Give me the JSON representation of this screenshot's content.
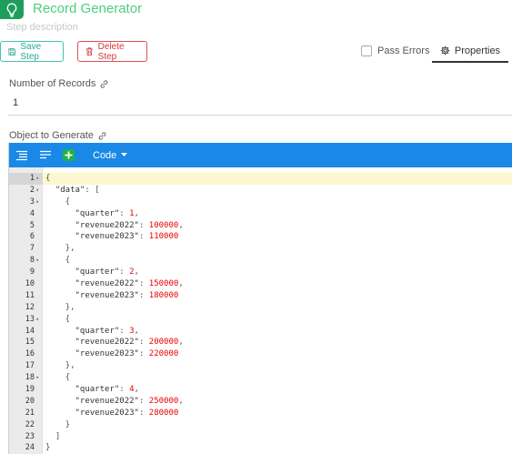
{
  "header": {
    "title": "Record Generator",
    "description_placeholder": "Step description"
  },
  "toolbar": {
    "save_label": "Save Step",
    "delete_label": "Delete Step",
    "pass_errors_label": "Pass Errors",
    "properties_label": "Properties"
  },
  "fields": {
    "records_label": "Number of Records",
    "records_value": "1",
    "object_label": "Object to Generate"
  },
  "editor": {
    "mode_label": "Code",
    "lines": [
      {
        "n": "1",
        "fold": true,
        "tokens": [
          [
            "p",
            "{"
          ]
        ]
      },
      {
        "n": "2",
        "fold": true,
        "tokens": [
          [
            "k",
            "  \"data\""
          ],
          [
            "p",
            ": ["
          ]
        ]
      },
      {
        "n": "3",
        "fold": true,
        "tokens": [
          [
            "p",
            "    {"
          ]
        ]
      },
      {
        "n": "4",
        "fold": false,
        "tokens": [
          [
            "k",
            "      \"quarter\""
          ],
          [
            "p",
            ": "
          ],
          [
            "n",
            "1"
          ],
          [
            "p",
            ","
          ]
        ]
      },
      {
        "n": "5",
        "fold": false,
        "tokens": [
          [
            "k",
            "      \"revenue2022\""
          ],
          [
            "p",
            ": "
          ],
          [
            "n",
            "100000"
          ],
          [
            "p",
            ","
          ]
        ]
      },
      {
        "n": "6",
        "fold": false,
        "tokens": [
          [
            "k",
            "      \"revenue2023\""
          ],
          [
            "p",
            ": "
          ],
          [
            "n",
            "110000"
          ]
        ]
      },
      {
        "n": "7",
        "fold": false,
        "tokens": [
          [
            "p",
            "    },"
          ]
        ]
      },
      {
        "n": "8",
        "fold": true,
        "tokens": [
          [
            "p",
            "    {"
          ]
        ]
      },
      {
        "n": "9",
        "fold": false,
        "tokens": [
          [
            "k",
            "      \"quarter\""
          ],
          [
            "p",
            ": "
          ],
          [
            "n",
            "2"
          ],
          [
            "p",
            ","
          ]
        ]
      },
      {
        "n": "10",
        "fold": false,
        "tokens": [
          [
            "k",
            "      \"revenue2022\""
          ],
          [
            "p",
            ": "
          ],
          [
            "n",
            "150000"
          ],
          [
            "p",
            ","
          ]
        ]
      },
      {
        "n": "11",
        "fold": false,
        "tokens": [
          [
            "k",
            "      \"revenue2023\""
          ],
          [
            "p",
            ": "
          ],
          [
            "n",
            "180000"
          ]
        ]
      },
      {
        "n": "12",
        "fold": false,
        "tokens": [
          [
            "p",
            "    },"
          ]
        ]
      },
      {
        "n": "13",
        "fold": true,
        "tokens": [
          [
            "p",
            "    {"
          ]
        ]
      },
      {
        "n": "14",
        "fold": false,
        "tokens": [
          [
            "k",
            "      \"quarter\""
          ],
          [
            "p",
            ": "
          ],
          [
            "n",
            "3"
          ],
          [
            "p",
            ","
          ]
        ]
      },
      {
        "n": "15",
        "fold": false,
        "tokens": [
          [
            "k",
            "      \"revenue2022\""
          ],
          [
            "p",
            ": "
          ],
          [
            "n",
            "200000"
          ],
          [
            "p",
            ","
          ]
        ]
      },
      {
        "n": "16",
        "fold": false,
        "tokens": [
          [
            "k",
            "      \"revenue2023\""
          ],
          [
            "p",
            ": "
          ],
          [
            "n",
            "220000"
          ]
        ]
      },
      {
        "n": "17",
        "fold": false,
        "tokens": [
          [
            "p",
            "    },"
          ]
        ]
      },
      {
        "n": "18",
        "fold": true,
        "tokens": [
          [
            "p",
            "    {"
          ]
        ]
      },
      {
        "n": "19",
        "fold": false,
        "tokens": [
          [
            "k",
            "      \"quarter\""
          ],
          [
            "p",
            ": "
          ],
          [
            "n",
            "4"
          ],
          [
            "p",
            ","
          ]
        ]
      },
      {
        "n": "20",
        "fold": false,
        "tokens": [
          [
            "k",
            "      \"revenue2022\""
          ],
          [
            "p",
            ": "
          ],
          [
            "n",
            "250000"
          ],
          [
            "p",
            ","
          ]
        ]
      },
      {
        "n": "21",
        "fold": false,
        "tokens": [
          [
            "k",
            "      \"revenue2023\""
          ],
          [
            "p",
            ": "
          ],
          [
            "n",
            "280000"
          ]
        ]
      },
      {
        "n": "22",
        "fold": false,
        "tokens": [
          [
            "p",
            "    }"
          ]
        ]
      },
      {
        "n": "23",
        "fold": false,
        "tokens": [
          [
            "p",
            "  ]"
          ]
        ]
      },
      {
        "n": "24",
        "fold": false,
        "tokens": [
          [
            "p",
            "}"
          ]
        ]
      }
    ]
  },
  "colors": {
    "accent_green": "#4cd07a",
    "toolbar_blue": "#1a88e6",
    "number_red": "#ee0000",
    "save_teal": "#40c4b0",
    "delete_red": "#e05050"
  },
  "icons": {
    "app": "lightbulb-icon",
    "save": "save-icon",
    "delete": "trash-icon",
    "properties": "gear-icon",
    "link": "link-icon",
    "format": "format-icon",
    "compact": "compact-icon",
    "add": "add-icon",
    "dropdown": "chevron-down-icon"
  }
}
